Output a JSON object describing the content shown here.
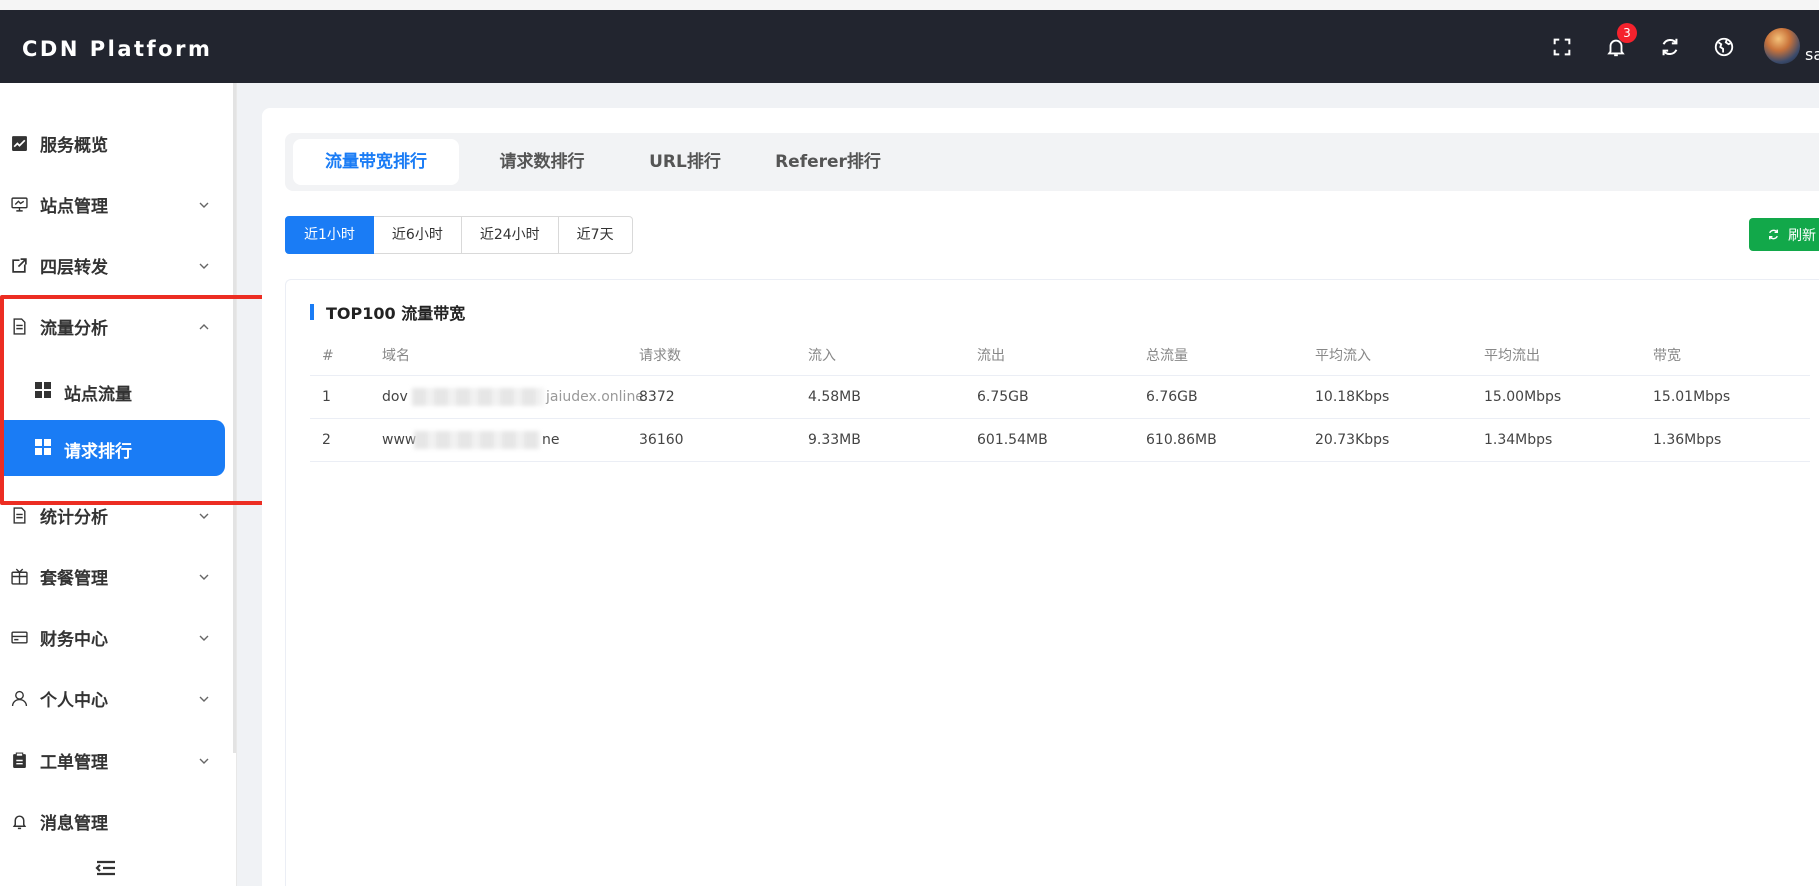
{
  "header": {
    "brand": "CDN Platform",
    "notification_count": "3",
    "username": "sa",
    "icons": [
      "fullscreen-icon",
      "bell-icon",
      "refresh-icon",
      "globe-icon"
    ]
  },
  "sidebar": {
    "items": [
      {
        "label": "服务概览",
        "icon": "chart-icon",
        "expandable": false
      },
      {
        "label": "站点管理",
        "icon": "monitor-icon",
        "expandable": true
      },
      {
        "label": "四层转发",
        "icon": "share-icon",
        "expandable": true
      },
      {
        "label": "流量分析",
        "icon": "document-icon",
        "expandable": true,
        "expanded": true
      },
      {
        "label": "统计分析",
        "icon": "document-icon",
        "expandable": true
      },
      {
        "label": "套餐管理",
        "icon": "package-icon",
        "expandable": true
      },
      {
        "label": "财务中心",
        "icon": "card-icon",
        "expandable": true
      },
      {
        "label": "个人中心",
        "icon": "user-icon",
        "expandable": true
      },
      {
        "label": "工单管理",
        "icon": "clipboard-icon",
        "expandable": true
      },
      {
        "label": "消息管理",
        "icon": "bell-icon",
        "expandable": false
      }
    ],
    "subitems": [
      {
        "label": "站点流量",
        "active": false
      },
      {
        "label": "请求排行",
        "active": true
      }
    ]
  },
  "tabs": [
    {
      "label": "流量带宽排行",
      "active": true
    },
    {
      "label": "请求数排行",
      "active": false
    },
    {
      "label": "URL排行",
      "active": false
    },
    {
      "label": "Referer排行",
      "active": false
    }
  ],
  "time_ranges": [
    {
      "label": "近1小时",
      "active": true
    },
    {
      "label": "近6小时",
      "active": false
    },
    {
      "label": "近24小时",
      "active": false
    },
    {
      "label": "近7天",
      "active": false
    }
  ],
  "refresh_label": "刷新",
  "section_title": "TOP100 流量带宽",
  "table": {
    "columns": [
      "#",
      "域名",
      "请求数",
      "流入",
      "流出",
      "总流量",
      "平均流入",
      "平均流出",
      "带宽"
    ],
    "rows": [
      [
        "1",
        "dov",
        "8372",
        "4.58MB",
        "6.75GB",
        "6.76GB",
        "10.18Kbps",
        "15.00Mbps",
        "15.01Mbps"
      ],
      [
        "2",
        "www",
        "36160",
        "9.33MB",
        "601.54MB",
        "610.86MB",
        "20.73Kbps",
        "1.34Mbps",
        "1.36Mbps"
      ]
    ],
    "domain_suffixes": [
      "jaiudex.online",
      "ne"
    ]
  },
  "colors": {
    "header_bg": "#22252f",
    "accent": "#1a7cf5",
    "refresh_green": "#12a84a",
    "highlight_red": "#ec2d22",
    "badge_red": "#f5222d"
  }
}
